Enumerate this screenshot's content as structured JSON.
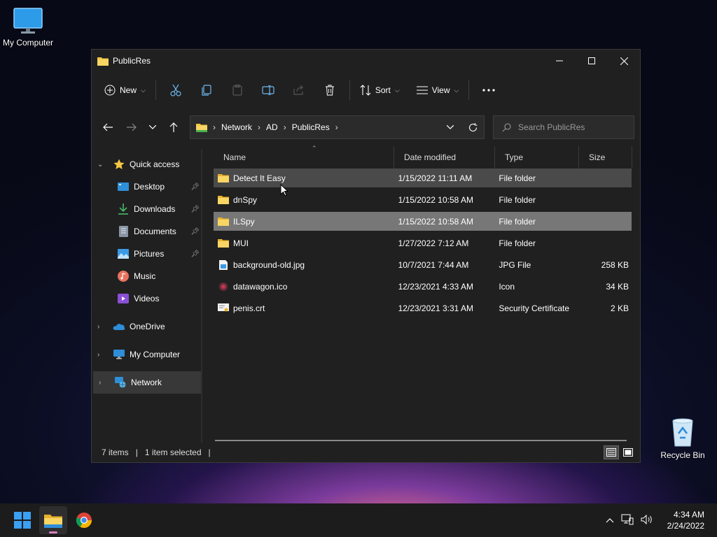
{
  "desktop": {
    "my_computer_label": "My Computer",
    "recycle_bin_label": "Recycle Bin"
  },
  "window": {
    "title": "PublicRes",
    "toolbar": {
      "new_label": "New",
      "sort_label": "Sort",
      "view_label": "View"
    },
    "address": {
      "crumbs": [
        "Network",
        "AD",
        "PublicRes"
      ]
    },
    "search": {
      "placeholder": "Search PublicRes"
    },
    "sidebar": {
      "quick_access": "Quick access",
      "items": [
        {
          "label": "Desktop",
          "icon": "desktop-icon"
        },
        {
          "label": "Downloads",
          "icon": "download-icon"
        },
        {
          "label": "Documents",
          "icon": "document-icon"
        },
        {
          "label": "Pictures",
          "icon": "picture-icon"
        },
        {
          "label": "Music",
          "icon": "music-icon"
        },
        {
          "label": "Videos",
          "icon": "video-icon"
        }
      ],
      "onedrive": "OneDrive",
      "my_computer": "My Computer",
      "network": "Network"
    },
    "columns": {
      "name": "Name",
      "date": "Date modified",
      "type": "Type",
      "size": "Size"
    },
    "files": [
      {
        "name": "Detect It Easy",
        "date": "1/15/2022 11:11 AM",
        "type": "File folder",
        "size": "",
        "icon": "folder-icon",
        "state": "hover"
      },
      {
        "name": "dnSpy",
        "date": "1/15/2022 10:58 AM",
        "type": "File folder",
        "size": "",
        "icon": "folder-icon",
        "state": ""
      },
      {
        "name": "ILSpy",
        "date": "1/15/2022 10:58 AM",
        "type": "File folder",
        "size": "",
        "icon": "folder-icon",
        "state": "selected"
      },
      {
        "name": "MUI",
        "date": "1/27/2022 7:12 AM",
        "type": "File folder",
        "size": "",
        "icon": "folder-icon",
        "state": ""
      },
      {
        "name": "background-old.jpg",
        "date": "10/7/2021 7:44 AM",
        "type": "JPG File",
        "size": "258 KB",
        "icon": "image-file-icon",
        "state": ""
      },
      {
        "name": "datawagon.ico",
        "date": "12/23/2021 4:33 AM",
        "type": "Icon",
        "size": "34 KB",
        "icon": "ico-file-icon",
        "state": ""
      },
      {
        "name": "penis.crt",
        "date": "12/23/2021 3:31 AM",
        "type": "Security Certificate",
        "size": "2 KB",
        "icon": "certificate-file-icon",
        "state": ""
      }
    ],
    "status": {
      "items": "7 items",
      "selected": "1 item selected"
    }
  },
  "taskbar": {
    "time": "4:34 AM",
    "date": "2/24/2022"
  },
  "colors": {
    "folder": "#f4c744",
    "accent": "#3aa0f3",
    "window_bg": "#202020"
  }
}
